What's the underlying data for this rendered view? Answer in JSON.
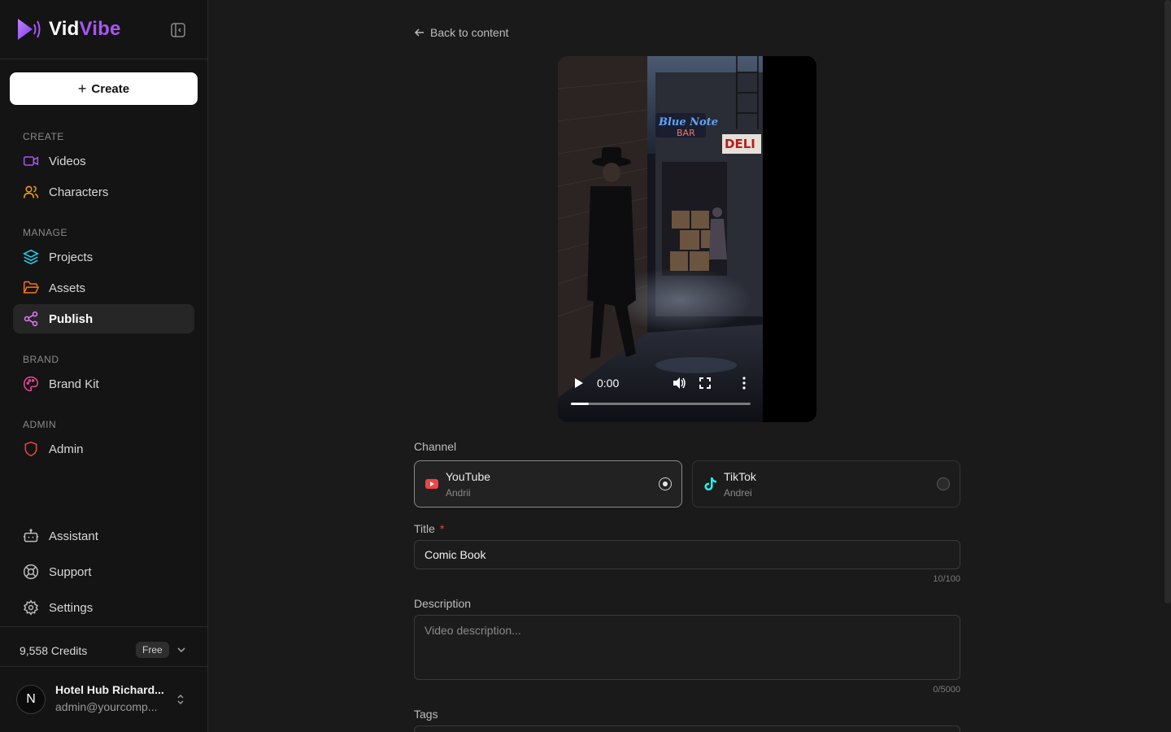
{
  "app": {
    "name_part1": "Vid",
    "name_part2": "Vibe",
    "accent_color": "#a855f7"
  },
  "sidebar": {
    "create_label": "Create",
    "sections": {
      "create": "CREATE",
      "manage": "MANAGE",
      "brand": "BRAND",
      "admin": "ADMIN"
    },
    "items": {
      "videos": "Videos",
      "characters": "Characters",
      "projects": "Projects",
      "assets": "Assets",
      "publish": "Publish",
      "brand_kit": "Brand Kit",
      "admin": "Admin",
      "assistant": "Assistant",
      "support": "Support",
      "settings": "Settings"
    },
    "active_item": "Publish",
    "credits": "9,558 Credits",
    "plan_badge": "Free",
    "user": {
      "avatar_letter": "N",
      "name": "Hotel Hub Richard...",
      "email": "admin@yourcomp..."
    }
  },
  "main": {
    "back_label": "Back to content",
    "video": {
      "time": "0:00",
      "progress": 0.1,
      "neon_sign_1": "Blue Note",
      "neon_sign_2": "BAR",
      "store_sign": "DELI"
    },
    "channel_label": "Channel",
    "channels": [
      {
        "name": "YouTube",
        "account": "Andrii",
        "selected": true,
        "icon": "youtube-icon",
        "color": "#ef4444"
      },
      {
        "name": "TikTok",
        "account": "Andrei",
        "selected": false,
        "icon": "tiktok-icon",
        "color": "#25f4ee"
      }
    ],
    "title_label": "Title",
    "required_mark": "*",
    "title_value": "Comic Book",
    "title_counter": "10/100",
    "description_label": "Description",
    "description_placeholder": "Video description...",
    "description_counter": "0/5000",
    "tags_label": "Tags"
  }
}
